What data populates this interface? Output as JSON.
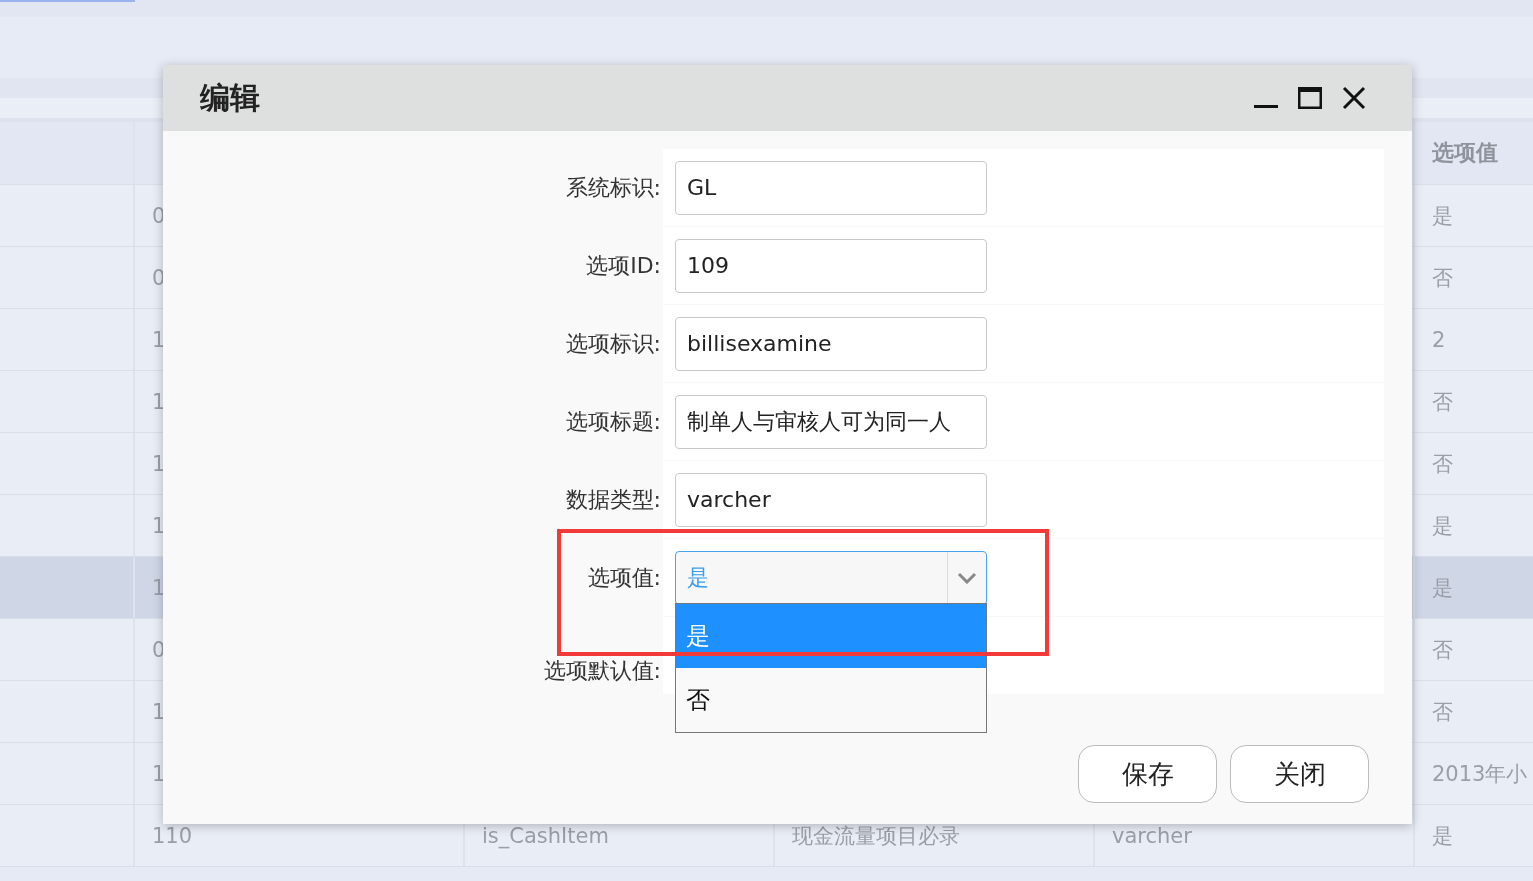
{
  "table": {
    "last_column_heading": "选项值",
    "rows": [
      {
        "column_2": "0",
        "column_6": "是",
        "selected": false
      },
      {
        "column_2": "0",
        "column_6": "否",
        "selected": false
      },
      {
        "column_2": "1",
        "column_6": "2",
        "selected": false
      },
      {
        "column_2": "1",
        "column_6": "否",
        "selected": false
      },
      {
        "column_2": "1",
        "column_6": "否",
        "selected": false
      },
      {
        "column_2": "1",
        "column_6": "是",
        "selected": false
      },
      {
        "column_2": "1",
        "column_6": "是",
        "selected": true
      },
      {
        "column_2": "0",
        "column_6": "否",
        "selected": false
      },
      {
        "column_2": "1",
        "column_6": "否",
        "selected": false
      },
      {
        "column_2": "1",
        "column_6": "2013年小",
        "selected": false
      },
      {
        "column_2": "110",
        "column_3": "is_CashItem",
        "column_4": "现金流量项目必录",
        "column_5": "varcher",
        "column_6": "是",
        "selected": false
      }
    ]
  },
  "dialog": {
    "title": "编辑",
    "fields": [
      {
        "kind": "text",
        "label": "系统标识:",
        "value": "GL"
      },
      {
        "kind": "text",
        "label": "选项ID:",
        "value": "109"
      },
      {
        "kind": "text",
        "label": "选项标识:",
        "value": "billisexamine"
      },
      {
        "kind": "text",
        "label": "选项标题:",
        "value": "制单人与审核人可为同一人"
      },
      {
        "kind": "text",
        "label": "数据类型:",
        "value": "varcher"
      },
      {
        "kind": "select",
        "label": "选项值:",
        "value": "是",
        "expanded": true,
        "options": [
          {
            "label": "是",
            "selected": true
          },
          {
            "label": "否",
            "selected": false
          }
        ]
      },
      {
        "kind": "covered",
        "label": "选项默认值:"
      }
    ],
    "buttons": [
      "保存",
      "关闭"
    ]
  }
}
